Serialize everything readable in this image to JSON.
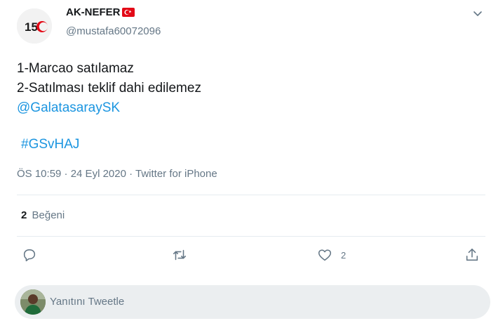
{
  "author": {
    "display_name": "AK-NEFER",
    "handle": "@mustafa60072096",
    "flag_icon": "turkey-flag-icon",
    "avatar_text": "150"
  },
  "tweet": {
    "line1": "1-Marcao satılamaz",
    "line2": "2-Satılması teklif dahi edilemez",
    "mention": "@GalatasaraySK",
    "hashtag": "#GSvHAJ",
    "meta": "ÖS 10:59 · 24 Eyl 2020 · Twitter for iPhone"
  },
  "stats": {
    "likes_count": "2",
    "likes_label": "Beğeni"
  },
  "actions": {
    "like_count": "2"
  },
  "reply": {
    "placeholder": "Yanıtını Tweetle"
  },
  "colors": {
    "link": "#1b95e0",
    "secondary_text": "#657786",
    "divider": "#e6ecf0",
    "reply_box": "#ebeef0",
    "flag_red": "#e30a17"
  }
}
